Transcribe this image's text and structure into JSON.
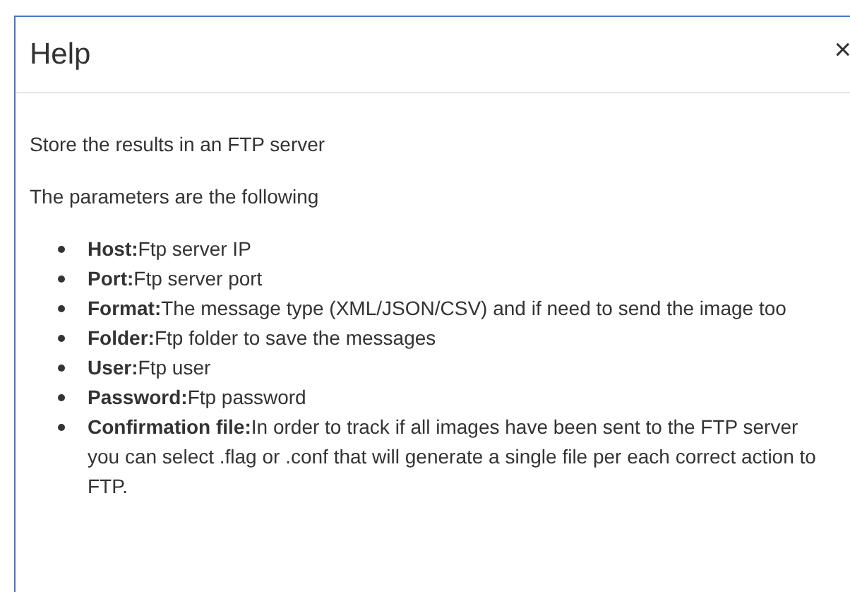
{
  "dialog": {
    "title": "Help",
    "close": "×"
  },
  "intro": "Store the results in an FTP server",
  "lead": "The parameters are the following",
  "parameters": [
    {
      "text": "**Host:**Ftp server IP"
    },
    {
      "text": "**Port:**Ftp server port"
    },
    {
      "text": "**Format:**The message type (XML/JSON/CSV) and if need to send the image too"
    },
    {
      "text": "**Folder:**Ftp folder to save the messages"
    },
    {
      "text": "**User:**Ftp user"
    },
    {
      "text": "**Password:**Ftp password"
    },
    {
      "text": "**Confirmation file:**In order to track if all images have been sent to the FTP server you can select .flag or .conf that will generate a single file per each correct action to FTP."
    }
  ]
}
